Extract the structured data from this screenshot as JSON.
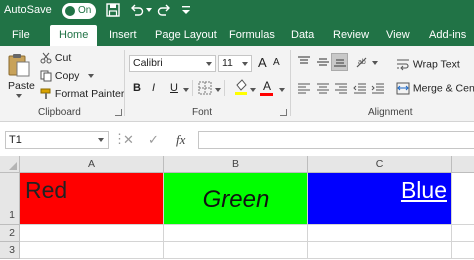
{
  "titlebar": {
    "autosave_label": "AutoSave",
    "toggle_state": "On",
    "icons": [
      "save-icon",
      "undo-icon",
      "redo-icon",
      "customize-qat-icon"
    ]
  },
  "tabs": [
    "File",
    "Home",
    "Insert",
    "Page Layout",
    "Formulas",
    "Data",
    "Review",
    "View",
    "Add-ins"
  ],
  "active_tab": "Home",
  "ribbon": {
    "clipboard": {
      "paste": "Paste",
      "cut": "Cut",
      "copy": "Copy",
      "format_painter": "Format Painter",
      "group_label": "Clipboard"
    },
    "font": {
      "font_name": "Calibri",
      "font_size": "11",
      "bold": "B",
      "italic": "I",
      "underline": "U",
      "grow": "A",
      "shrink": "A",
      "font_color_glyph": "A",
      "group_label": "Font"
    },
    "alignment": {
      "wrap_text": "Wrap Text",
      "merge_center": "Merge & Cent",
      "group_label": "Alignment"
    }
  },
  "formula_bar": {
    "name_box": "T1",
    "fx": "fx",
    "value": ""
  },
  "grid": {
    "columns": [
      "A",
      "B",
      "C"
    ],
    "rows": [
      "1",
      "2",
      "3"
    ],
    "cells": {
      "A1": {
        "text": "Red",
        "fill": "#ff0000"
      },
      "B1": {
        "text": "Green",
        "fill": "#00ff00"
      },
      "C1": {
        "text": "Blue",
        "fill": "#0000ff"
      }
    }
  },
  "colors": {
    "brand": "#217346",
    "ribbon_bg": "#f3f3f3",
    "header_bg": "#e6e6e6"
  }
}
